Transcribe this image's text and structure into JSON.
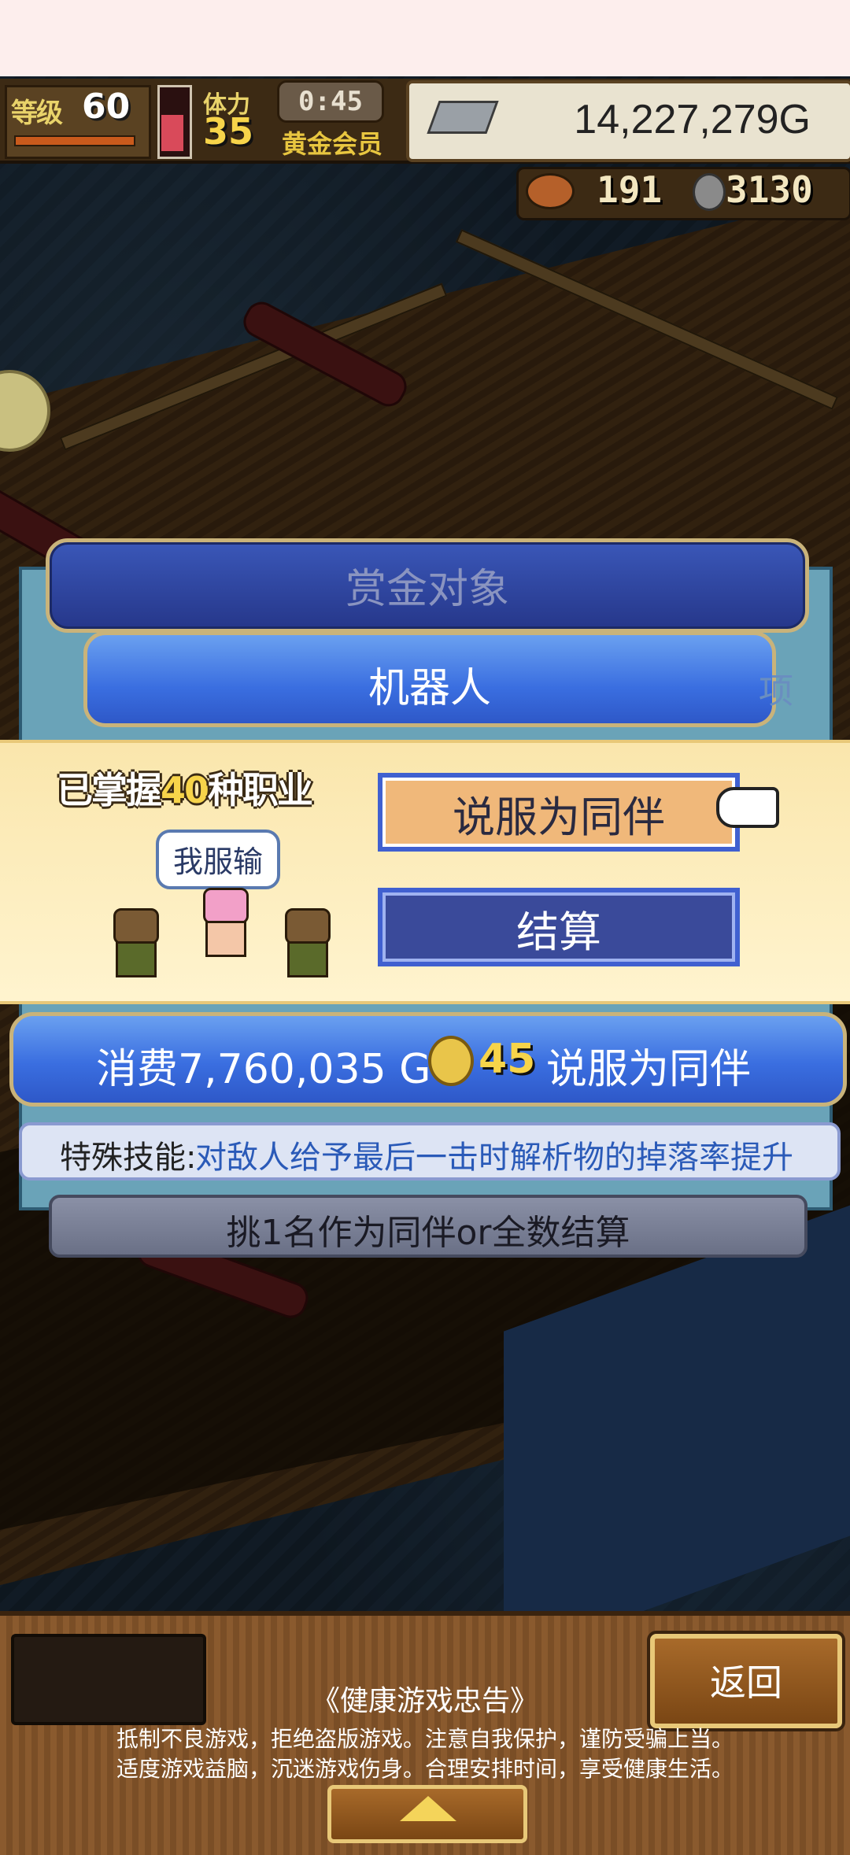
{
  "hud": {
    "level_label": "等级",
    "level_value": "60",
    "stamina_label": "体力",
    "stamina_value": "35",
    "timer": "0:45",
    "membership": "黄金会员",
    "money": "14,227,279G",
    "meat_count": "191",
    "medal_count": "3130"
  },
  "modal": {
    "title": "赏金对象",
    "target_name": "机器人",
    "partial_text": "项",
    "mastered_prefix": "已掌握",
    "mastered_count": "40",
    "mastered_suffix": "种职业",
    "speech": "我服输",
    "persuade_button": "说服为同伴",
    "settle_button": "结算",
    "cost_text": "消费7,760,035 G",
    "coin_cost": "45",
    "cost_suffix": "说服为同伴",
    "skill_label": "特殊技能:",
    "skill_value": "对敌人给予最后一击时解析物的掉落率提升",
    "instruction": "挑1名作为同伴or全数结算"
  },
  "footer": {
    "back_button": "返回",
    "advice_title": "《健康游戏忠告》",
    "advice_line1": "抵制不良游戏，拒绝盗版游戏。注意自我保护，谨防受骗上当。",
    "advice_line2": "适度游戏益脑，沉迷游戏伤身。合理安排时间，享受健康生活。"
  },
  "colors": {
    "accent_blue": "#3a6ee0",
    "gold_text": "#f7d44a",
    "persuade_fill": "#f0b87a",
    "settle_fill": "#3a4a9a"
  },
  "icons": [
    "hp-gauge-icon",
    "silver-bar-icon",
    "meat-icon",
    "medal-icon",
    "gold-coin-icon",
    "pointing-hand-icon",
    "up-arrow-icon"
  ]
}
